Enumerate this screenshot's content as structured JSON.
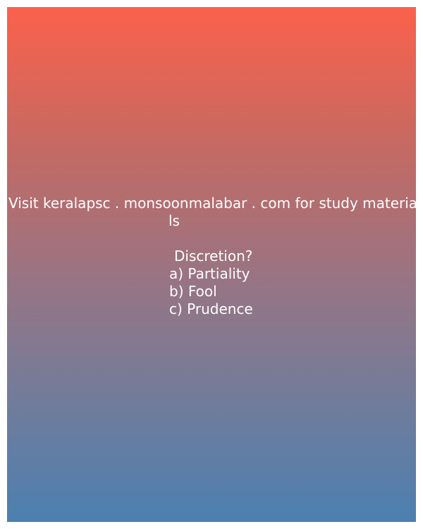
{
  "source_text_line1": "Visit keralapsc . monsoonmalabar . com for study materia",
  "source_text_line2": "ls",
  "question": "Discretion?",
  "options": [
    "a) Partiality",
    "b) Fool",
    "c) Prudence"
  ],
  "colors": {
    "gradient_top": "#fb614b",
    "gradient_bottom": "#4c80b0",
    "text": "#ffffff"
  }
}
